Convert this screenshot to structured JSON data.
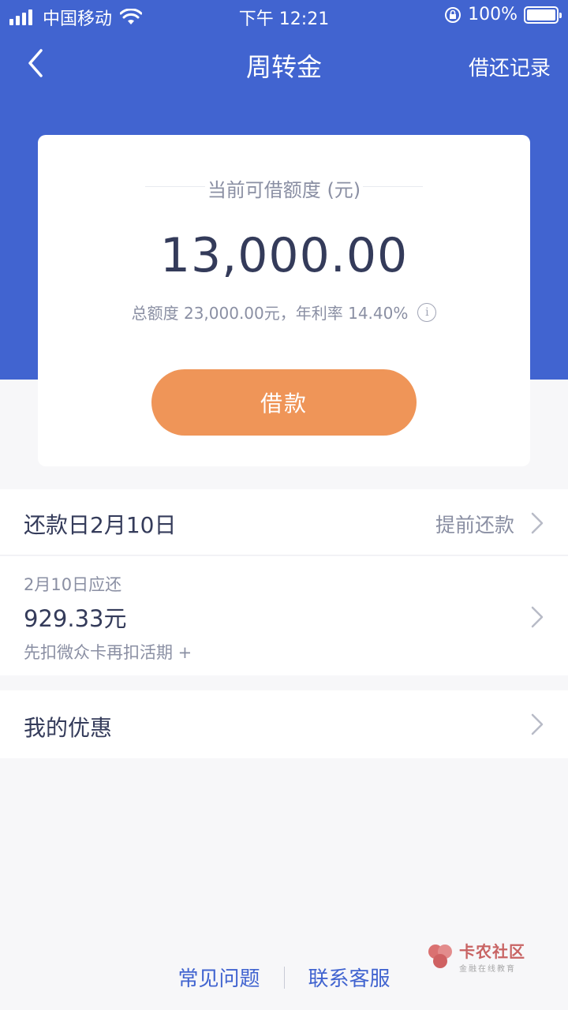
{
  "status_bar": {
    "carrier": "中国移动",
    "time": "下午 12:21",
    "battery": "100%",
    "icons": [
      "signal-icon",
      "wifi-icon",
      "orientation-lock-icon",
      "battery-icon"
    ]
  },
  "nav": {
    "title": "周转金",
    "right_link": "借还记录",
    "back_icon": "chevron-left-icon"
  },
  "card": {
    "label": "当前可借额度 (元)",
    "amount": "13,000.00",
    "subtitle": "总额度 23,000.00元，年利率 14.40%",
    "info_icon": "info-icon",
    "button": "借款"
  },
  "repayment": {
    "title": "还款日2月10日",
    "link": "提前还款",
    "due_label": "2月10日应还",
    "due_amount": "929.33元",
    "deduct_note": "先扣微众卡再扣活期 +"
  },
  "coupon": {
    "title": "我的优惠"
  },
  "footer": {
    "faq": "常见问题",
    "contact": "联系客服"
  },
  "watermark": {
    "title": "卡农社区",
    "subtitle": "金融在线教育"
  },
  "colors": {
    "primary": "#4164d0",
    "button": "#ef9558",
    "text_dark": "#343b5a",
    "text_gray": "#8a8fa3"
  }
}
